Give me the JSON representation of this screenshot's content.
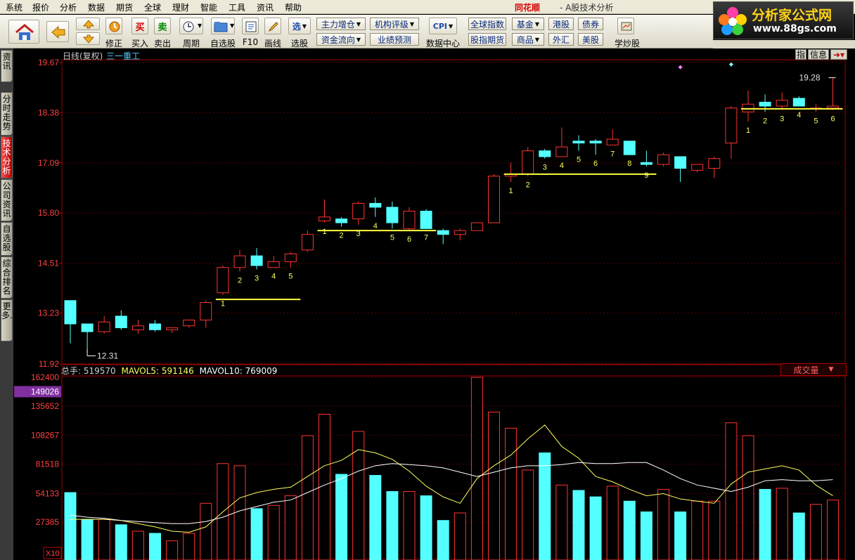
{
  "menu": [
    "系统",
    "报价",
    "分析",
    "数据",
    "期货",
    "全球",
    "理财",
    "智能",
    "工具",
    "资讯",
    "帮助"
  ],
  "app": {
    "brand": "同花顺",
    "subtitle": "- A股技术分析"
  },
  "ad": {
    "title": "分析家公式网",
    "url": "www.88gs.com"
  },
  "toolbar": {
    "buttons": [
      {
        "label": "",
        "icon": "home-icon"
      },
      {
        "label": "",
        "icon": "back-arrow-icon"
      },
      {
        "label": "",
        "icon": "up-down-arrows-icon"
      },
      {
        "label": "修正",
        "icon": "refresh-icon"
      },
      {
        "label": "买入",
        "glyph": "买"
      },
      {
        "label": "卖出",
        "glyph": "卖"
      },
      {
        "label": "周期",
        "icon": "clock-icon"
      },
      {
        "label": "自选股",
        "icon": "folder-icon"
      },
      {
        "label": "F10",
        "icon": "document-icon"
      },
      {
        "label": "画线",
        "icon": "pencil-icon"
      },
      {
        "label": "选股",
        "glyph": "选"
      },
      {
        "label": "数据中心",
        "glyph": "CPI"
      },
      {
        "label": "学炒股",
        "icon": "learn-icon"
      }
    ],
    "small": [
      "主力增仓",
      "机构评级",
      "资金流向",
      "业绩预测",
      "全球指数",
      "基金",
      "港股",
      "债券",
      "股指期货",
      "商品",
      "外汇",
      "美股"
    ]
  },
  "sidetabs": [
    "资讯",
    "分时走势",
    "技术分析",
    "公司资讯",
    "自选股",
    "综合排名",
    "更多..."
  ],
  "chart": {
    "period_label": "日线(复权)",
    "stock_name": "三一重工",
    "info_buttons": [
      "指",
      "信息"
    ],
    "price_axis_labels": [
      "19.67",
      "18.38",
      "17.09",
      "15.80",
      "14.51",
      "13.23",
      "11.92"
    ],
    "price_axis_values": [
      19.67,
      18.38,
      17.09,
      15.8,
      14.51,
      13.23,
      11.92
    ],
    "price_range": [
      11.92,
      19.67
    ],
    "low_marker": {
      "index": 1,
      "price": 12.31,
      "label": "12.31"
    },
    "high_marker": {
      "index": 45,
      "price": 19.28,
      "label": "19.28"
    },
    "up_color": "#ff3232",
    "down_color": "#54ffff",
    "ma_colors": [
      "#ffff60",
      "#ffffff"
    ],
    "platform_color": "#ffff40",
    "diamond_color": "#ff80ff",
    "diamond_color2": "#80ffff",
    "candles": [
      {
        "o": 13.55,
        "h": 13.55,
        "l": 12.45,
        "c": 12.95
      },
      {
        "o": 12.95,
        "h": 12.95,
        "l": 12.31,
        "c": 12.75
      },
      {
        "o": 12.75,
        "h": 13.15,
        "l": 12.7,
        "c": 13.0
      },
      {
        "o": 13.15,
        "h": 13.3,
        "l": 12.8,
        "c": 12.85
      },
      {
        "o": 12.8,
        "h": 13.05,
        "l": 12.7,
        "c": 12.9
      },
      {
        "o": 12.95,
        "h": 13.05,
        "l": 12.75,
        "c": 12.8
      },
      {
        "o": 12.8,
        "h": 12.85,
        "l": 12.72,
        "c": 12.85
      },
      {
        "o": 12.9,
        "h": 13.05,
        "l": 12.85,
        "c": 13.05
      },
      {
        "o": 13.05,
        "h": 13.55,
        "l": 12.85,
        "c": 13.5
      },
      {
        "o": 13.75,
        "h": 14.45,
        "l": 13.7,
        "c": 14.4
      },
      {
        "o": 14.4,
        "h": 14.85,
        "l": 14.3,
        "c": 14.7
      },
      {
        "o": 14.7,
        "h": 14.9,
        "l": 14.35,
        "c": 14.45
      },
      {
        "o": 14.4,
        "h": 14.7,
        "l": 14.4,
        "c": 14.55
      },
      {
        "o": 14.55,
        "h": 14.8,
        "l": 14.4,
        "c": 14.75
      },
      {
        "o": 14.85,
        "h": 15.35,
        "l": 14.8,
        "c": 15.25
      },
      {
        "o": 15.6,
        "h": 16.15,
        "l": 15.55,
        "c": 15.7
      },
      {
        "o": 15.65,
        "h": 15.7,
        "l": 15.45,
        "c": 15.55
      },
      {
        "o": 15.65,
        "h": 16.1,
        "l": 15.5,
        "c": 16.05
      },
      {
        "o": 16.05,
        "h": 16.2,
        "l": 15.7,
        "c": 15.95
      },
      {
        "o": 15.95,
        "h": 16.1,
        "l": 15.4,
        "c": 15.55
      },
      {
        "o": 15.4,
        "h": 15.95,
        "l": 15.35,
        "c": 15.85
      },
      {
        "o": 15.85,
        "h": 15.9,
        "l": 15.4,
        "c": 15.4
      },
      {
        "o": 15.35,
        "h": 15.4,
        "l": 15.0,
        "c": 15.25
      },
      {
        "o": 15.25,
        "h": 15.4,
        "l": 15.1,
        "c": 15.35
      },
      {
        "o": 15.35,
        "h": 15.55,
        "l": 15.35,
        "c": 15.55
      },
      {
        "o": 15.55,
        "h": 16.8,
        "l": 15.55,
        "c": 16.75
      },
      {
        "o": 16.75,
        "h": 17.1,
        "l": 16.6,
        "c": 16.8
      },
      {
        "o": 16.8,
        "h": 17.5,
        "l": 16.75,
        "c": 17.4
      },
      {
        "o": 17.4,
        "h": 17.45,
        "l": 17.2,
        "c": 17.25
      },
      {
        "o": 17.25,
        "h": 18.0,
        "l": 17.25,
        "c": 17.5
      },
      {
        "o": 17.65,
        "h": 17.8,
        "l": 17.4,
        "c": 17.6
      },
      {
        "o": 17.65,
        "h": 17.7,
        "l": 17.3,
        "c": 17.6
      },
      {
        "o": 17.55,
        "h": 17.95,
        "l": 17.55,
        "c": 17.7
      },
      {
        "o": 17.65,
        "h": 17.65,
        "l": 17.3,
        "c": 17.3
      },
      {
        "o": 17.1,
        "h": 17.4,
        "l": 17.0,
        "c": 17.05
      },
      {
        "o": 17.05,
        "h": 17.35,
        "l": 17.0,
        "c": 17.3
      },
      {
        "o": 17.25,
        "h": 17.25,
        "l": 16.6,
        "c": 16.95
      },
      {
        "o": 16.9,
        "h": 17.05,
        "l": 16.85,
        "c": 17.05
      },
      {
        "o": 16.95,
        "h": 17.25,
        "l": 16.7,
        "c": 17.2
      },
      {
        "o": 17.6,
        "h": 18.55,
        "l": 17.2,
        "c": 18.5
      },
      {
        "o": 18.4,
        "h": 18.95,
        "l": 18.15,
        "c": 18.6
      },
      {
        "o": 18.65,
        "h": 18.85,
        "l": 18.4,
        "c": 18.55
      },
      {
        "o": 18.55,
        "h": 18.9,
        "l": 18.45,
        "c": 18.7
      },
      {
        "o": 18.75,
        "h": 18.8,
        "l": 18.55,
        "c": 18.55
      },
      {
        "o": 18.5,
        "h": 18.6,
        "l": 18.4,
        "c": 18.5
      },
      {
        "o": 18.5,
        "h": 19.28,
        "l": 18.45,
        "c": 18.55
      }
    ],
    "platforms": [
      {
        "start": 9,
        "end": 13,
        "price": 13.58,
        "labels": [
          "1",
          "2",
          "3",
          "4",
          "5"
        ]
      },
      {
        "start": 15,
        "end": 21,
        "price": 15.35,
        "labels": [
          "1",
          "2",
          "3",
          "4",
          "5",
          "6",
          "7"
        ]
      },
      {
        "start": 26,
        "end": 34,
        "price": 16.8,
        "labels": [
          "1",
          "2",
          "3",
          "4",
          "5",
          "6",
          "7",
          "8",
          "9"
        ]
      },
      {
        "start": 40,
        "end": 45,
        "price": 18.48,
        "labels": [
          "1",
          "2",
          "3",
          "4",
          "5",
          "6"
        ]
      }
    ],
    "diamonds": [
      {
        "index": 36,
        "price": 19.55,
        "color": "#ff80ff"
      },
      {
        "index": 39,
        "price": 19.62,
        "color": "#80ffff"
      }
    ],
    "volume": {
      "label_total": "总手: 519570",
      "label_ma5": "MAVOL5: 591146",
      "label_ma10": "MAVOL10: 769009",
      "selector": "成交量",
      "highlight_value": "149026",
      "axis_labels": [
        "162400",
        "135652",
        "108267",
        "81518",
        "54133",
        "27385",
        "X10"
      ],
      "axis_values": [
        162400,
        135652,
        108267,
        81518,
        54133,
        27385
      ],
      "max": 162400,
      "bars": [
        55000,
        30000,
        30000,
        25000,
        19000,
        17000,
        10000,
        17000,
        45000,
        82000,
        80000,
        40000,
        43000,
        52000,
        108000,
        128000,
        72000,
        112000,
        71000,
        56000,
        56000,
        52000,
        29000,
        36000,
        162400,
        130000,
        115000,
        76000,
        92000,
        62000,
        57000,
        51000,
        61000,
        47000,
        37000,
        58000,
        37000,
        47000,
        47000,
        120000,
        108000,
        58000,
        59000,
        36000,
        44000,
        48000
      ],
      "ma5": [
        30000,
        30000,
        30000,
        29000,
        26000,
        23000,
        19000,
        18000,
        23000,
        37000,
        50000,
        55000,
        58000,
        60000,
        70000,
        80000,
        85000,
        95000,
        92000,
        86000,
        75000,
        61000,
        51000,
        45000,
        68000,
        80000,
        90000,
        105000,
        118000,
        98000,
        87000,
        70000,
        65000,
        58000,
        52000,
        54000,
        49000,
        47000,
        45000,
        63000,
        74000,
        77000,
        80000,
        76000,
        62000,
        52000
      ],
      "ma10": [
        34000,
        32000,
        31000,
        29000,
        28000,
        27000,
        26000,
        26000,
        28000,
        32000,
        38000,
        42000,
        46000,
        48000,
        55000,
        62000,
        68000,
        75000,
        80000,
        82000,
        81000,
        80000,
        78000,
        74000,
        70000,
        74000,
        78000,
        80000,
        80000,
        81000,
        83000,
        82000,
        82000,
        83000,
        83000,
        76000,
        68000,
        62000,
        59000,
        56000,
        60000,
        66000,
        67000,
        66000,
        66000,
        67000
      ]
    }
  }
}
